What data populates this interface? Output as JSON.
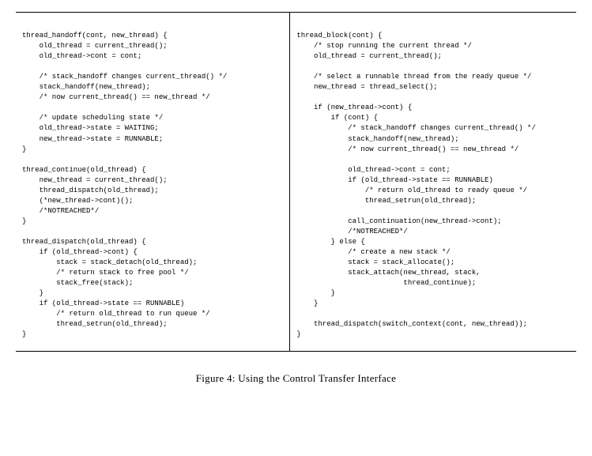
{
  "code": {
    "left": "\nthread_handoff(cont, new_thread) {\n    old_thread = current_thread();\n    old_thread->cont = cont;\n\n    /* stack_handoff changes current_thread() */\n    stack_handoff(new_thread);\n    /* now current_thread() == new_thread */\n\n    /* update scheduling state */\n    old_thread->state = WAITING;\n    new_thread->state = RUNNABLE;\n}\n\nthread_continue(old_thread) {\n    new_thread = current_thread();\n    thread_dispatch(old_thread);\n    (*new_thread->cont)();\n    /*NOTREACHED*/\n}\n\nthread_dispatch(old_thread) {\n    if (old_thread->cont) {\n        stack = stack_detach(old_thread);\n        /* return stack to free pool */\n        stack_free(stack);\n    }\n    if (old_thread->state == RUNNABLE)\n        /* return old_thread to run queue */\n        thread_setrun(old_thread);\n}",
    "right": "\nthread_block(cont) {\n    /* stop running the current thread */\n    old_thread = current_thread();\n\n    /* select a runnable thread from the ready queue */\n    new_thread = thread_select();\n\n    if (new_thread->cont) {\n        if (cont) {\n            /* stack_handoff changes current_thread() */\n            stack_handoff(new_thread);\n            /* now current_thread() == new_thread */\n\n            old_thread->cont = cont;\n            if (old_thread->state == RUNNABLE)\n                /* return old_thread to ready queue */\n                thread_setrun(old_thread);\n\n            call_continuation(new_thread->cont);\n            /*NOTREACHED*/\n        } else {\n            /* create a new stack */\n            stack = stack_allocate();\n            stack_attach(new_thread, stack,\n                         thread_continue);\n        }\n    }\n\n    thread_dispatch(switch_context(cont, new_thread));\n}"
  },
  "caption": "Figure 4: Using the Control Transfer Interface"
}
